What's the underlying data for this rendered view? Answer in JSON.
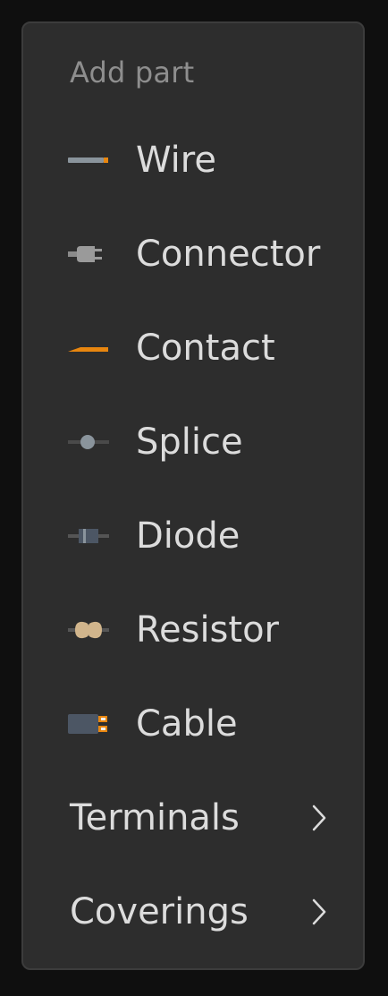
{
  "menu": {
    "title": "Add part",
    "items": [
      {
        "label": "Wire",
        "icon": "wire-icon"
      },
      {
        "label": "Connector",
        "icon": "connector-icon"
      },
      {
        "label": "Contact",
        "icon": "contact-icon"
      },
      {
        "label": "Splice",
        "icon": "splice-icon"
      },
      {
        "label": "Diode",
        "icon": "diode-icon"
      },
      {
        "label": "Resistor",
        "icon": "resistor-icon"
      },
      {
        "label": "Cable",
        "icon": "cable-icon"
      }
    ],
    "submenus": [
      {
        "label": "Terminals",
        "icon": "chevron-right-icon"
      },
      {
        "label": "Coverings",
        "icon": "chevron-right-icon"
      }
    ]
  },
  "colors": {
    "background": "#0f0f0f",
    "panel": "#2d2d2d",
    "panel_border": "#3c3c3c",
    "text": "#dcdcdc",
    "muted_text": "#8e8e8e",
    "accent_orange": "#e8860f",
    "wire_grey": "#8a949c",
    "resistor_tan": "#d1b58c"
  }
}
